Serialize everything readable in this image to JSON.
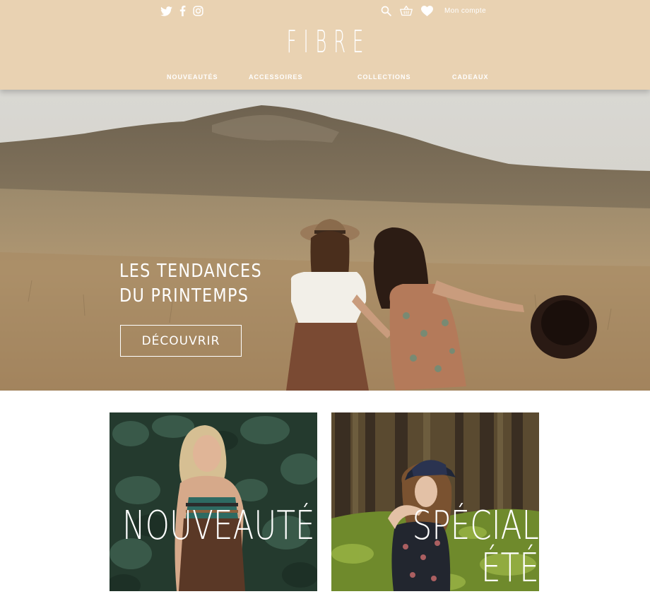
{
  "header": {
    "brand": "FIBRE",
    "account_label": "Mon compte",
    "social_icons": [
      "twitter-icon",
      "facebook-icon",
      "instagram-icon"
    ],
    "tool_icons": [
      "search-icon",
      "basket-icon",
      "heart-icon"
    ],
    "nav": [
      {
        "label": "NOUVEAUTÉS"
      },
      {
        "label": "ACCESSOIRES"
      },
      {
        "label": "COLLECTIONS"
      },
      {
        "label": "CADEAUX"
      }
    ]
  },
  "hero": {
    "title_line1": "LES TENDANCES",
    "title_line2": "DU PRINTEMPS",
    "cta_label": "DÉCOUVRIR"
  },
  "cards": [
    {
      "label": "NOUVEAUTÉS"
    },
    {
      "label_line1": "SPÉCIAL",
      "label_line2": "ÉTÉ"
    }
  ],
  "colors": {
    "header_bg": "#e9d2b2",
    "text_on_header": "#ffffff",
    "page_bg": "#ffffff"
  }
}
